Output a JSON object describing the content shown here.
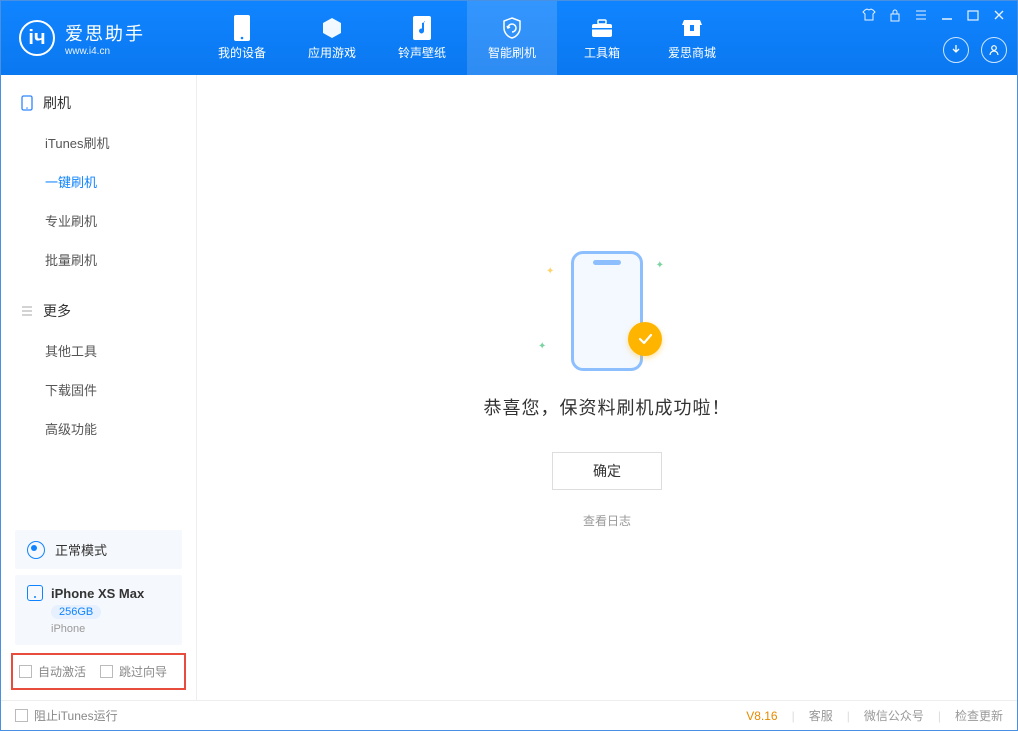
{
  "colors": {
    "primary": "#1084ff",
    "accent": "#ffb400",
    "highlight_border": "#e74c3c"
  },
  "logo": {
    "title": "爱思助手",
    "subtitle": "www.i4.cn"
  },
  "nav": {
    "items": [
      {
        "key": "device",
        "label": "我的设备"
      },
      {
        "key": "apps",
        "label": "应用游戏"
      },
      {
        "key": "ringtone",
        "label": "铃声壁纸"
      },
      {
        "key": "flash",
        "label": "智能刷机",
        "active": true
      },
      {
        "key": "toolbox",
        "label": "工具箱"
      },
      {
        "key": "shop",
        "label": "爱思商城"
      }
    ]
  },
  "sidebar": {
    "flash": {
      "title": "刷机",
      "items": [
        {
          "key": "itunes",
          "label": "iTunes刷机"
        },
        {
          "key": "oneclick",
          "label": "一键刷机",
          "active": true
        },
        {
          "key": "pro",
          "label": "专业刷机"
        },
        {
          "key": "batch",
          "label": "批量刷机"
        }
      ]
    },
    "more": {
      "title": "更多",
      "items": [
        {
          "key": "othertools",
          "label": "其他工具"
        },
        {
          "key": "firmware",
          "label": "下载固件"
        },
        {
          "key": "advanced",
          "label": "高级功能"
        }
      ]
    }
  },
  "device_status": {
    "mode_label": "正常模式"
  },
  "device_info": {
    "name": "iPhone XS Max",
    "capacity": "256GB",
    "type": "iPhone"
  },
  "options": {
    "auto_activate": {
      "label": "自动激活",
      "checked": false
    },
    "skip_guide": {
      "label": "跳过向导",
      "checked": false
    }
  },
  "content": {
    "success_message": "恭喜您，保资料刷机成功啦！",
    "ok_button": "确定",
    "view_log": "查看日志"
  },
  "footer": {
    "block_itunes": {
      "label": "阻止iTunes运行",
      "checked": false
    },
    "version": "V8.16",
    "links": {
      "support": "客服",
      "wechat": "微信公众号",
      "update": "检查更新"
    }
  }
}
